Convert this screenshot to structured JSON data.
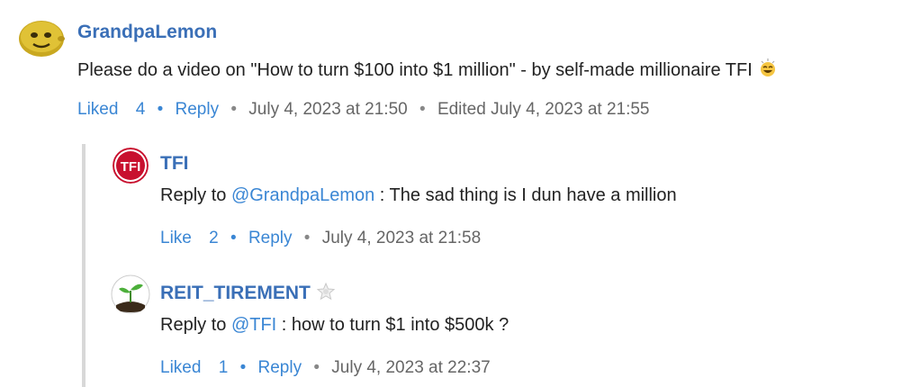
{
  "comments": [
    {
      "author": "GrandpaLemon",
      "avatar_icon": "lemon-avatar-icon",
      "text": "Please do a video on \"How to turn $100 into $1 million\" - by self-made millionaire TFI",
      "emoji_icon": "laughing-emoji-icon",
      "like_label": "Liked",
      "like_count": "4",
      "reply_label": "Reply",
      "timestamp": "July 4, 2023 at 21:50",
      "edited": "Edited July 4, 2023 at 21:55"
    },
    {
      "author": "TFI",
      "avatar_icon": "tfi-logo-avatar",
      "avatar_text": "TFI",
      "reply_prefix": "Reply to",
      "mention": "@GrandpaLemon",
      "text": ": The sad thing is I dun have a million",
      "like_label": "Like",
      "like_count": "2",
      "reply_label": "Reply",
      "timestamp": "July 4, 2023 at 21:58"
    },
    {
      "author": "REIT_TIREMENT",
      "avatar_icon": "sprout-avatar-icon",
      "badge_icon": "star-badge-icon",
      "reply_prefix": "Reply to",
      "mention": "@TFI",
      "text": ": how to turn $1 into $500k ?",
      "like_label": "Liked",
      "like_count": "1",
      "reply_label": "Reply",
      "timestamp": "July 4, 2023 at 22:37"
    }
  ],
  "colors": {
    "author": "#3a6fb7",
    "link": "#3a86d4",
    "meta": "#666666",
    "thread_bar": "#d8d8d8",
    "tfi_red": "#c8102e"
  }
}
